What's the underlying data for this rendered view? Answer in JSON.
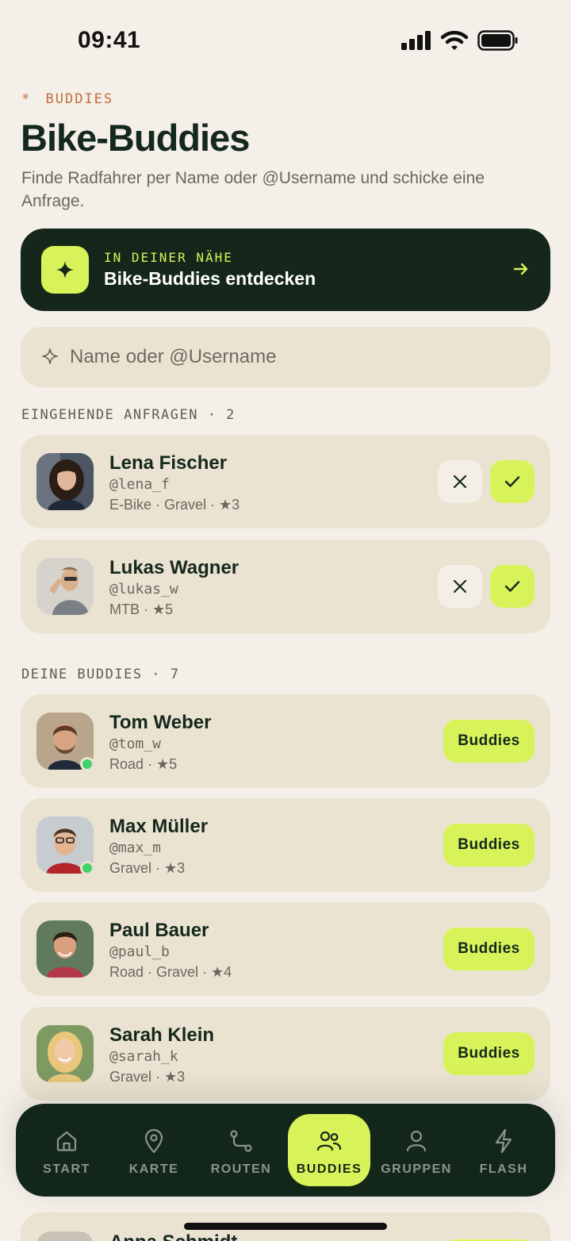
{
  "status_bar": {
    "time": "09:41"
  },
  "header": {
    "eyebrow": "BUDDIES",
    "title": "Bike-Buddies",
    "subtitle": "Finde Radfahrer per Name oder @Username und schicke eine Anfrage."
  },
  "discover": {
    "eyebrow": "IN DEINER NÄHE",
    "title": "Bike-Buddies entdecken"
  },
  "search": {
    "placeholder": "Name oder @Username",
    "value": ""
  },
  "incoming": {
    "label": "EINGEHENDE ANFRAGEN · 2",
    "items": [
      {
        "name": "Lena Fischer",
        "handle": "@lena_f",
        "meta": "E-Bike · Gravel · ★3"
      },
      {
        "name": "Lukas Wagner",
        "handle": "@lukas_w",
        "meta": "MTB · ★5"
      }
    ]
  },
  "buddies": {
    "label": "DEINE BUDDIES · 7",
    "button_label": "Buddies",
    "items": [
      {
        "name": "Tom Weber",
        "handle": "@tom_w",
        "meta": "Road · ★5",
        "online": true
      },
      {
        "name": "Max Müller",
        "handle": "@max_m",
        "meta": "Gravel · ★3",
        "online": true
      },
      {
        "name": "Paul Bauer",
        "handle": "@paul_b",
        "meta": "Road · Gravel · ★4",
        "online": false
      },
      {
        "name": "Sarah Klein",
        "handle": "@sarah_k",
        "meta": "Gravel · ★3",
        "online": false
      },
      {
        "name": "Anna Schmidt"
      }
    ]
  },
  "tabs": [
    {
      "label": "START",
      "icon": "home-icon"
    },
    {
      "label": "KARTE",
      "icon": "map-pin-icon"
    },
    {
      "label": "ROUTEN",
      "icon": "route-icon"
    },
    {
      "label": "BUDDIES",
      "icon": "buddies-icon",
      "active": true
    },
    {
      "label": "GRUPPEN",
      "icon": "user-icon"
    },
    {
      "label": "FLASH",
      "icon": "flash-icon"
    }
  ],
  "colors": {
    "background": "#f4efe8",
    "accent": "#d8f25a",
    "dark": "#13261a",
    "card": "#ebe3d1",
    "eyebrow": "#c46c3b",
    "online": "#3fd36b"
  }
}
